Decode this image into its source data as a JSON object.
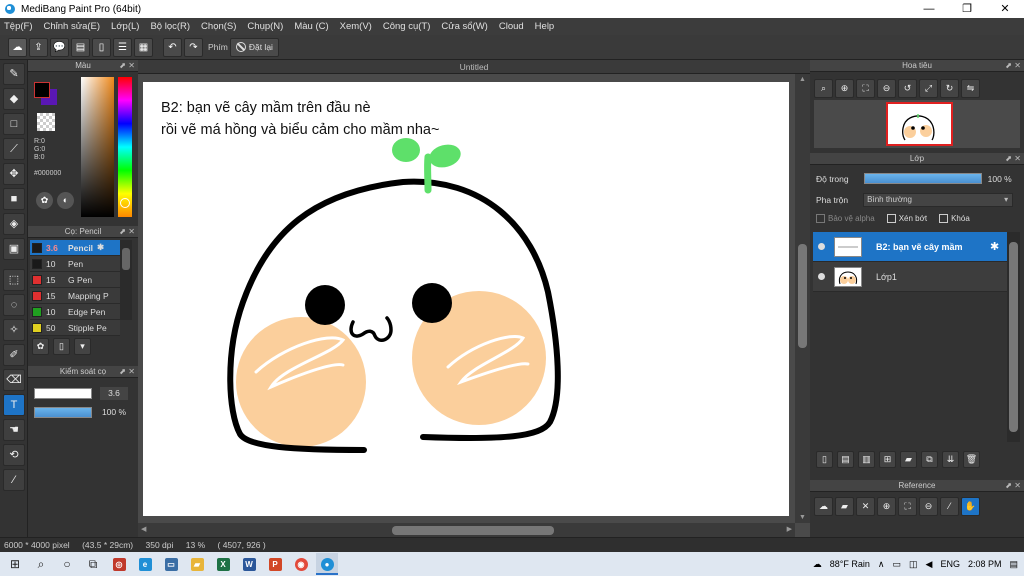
{
  "window": {
    "title": "MediBang Paint Pro (64bit)",
    "minimize": "—",
    "maximize": "❐",
    "close": "✕"
  },
  "menu": [
    "Tệp(F)",
    "Chỉnh sửa(E)",
    "Lớp(L)",
    "Bộ lọc(R)",
    "Chọn(S)",
    "Chụp(N)",
    "Màu (C)",
    "Xem(V)",
    "Công cụ(T)",
    "Cửa sổ(W)",
    "Cloud",
    "Help"
  ],
  "toolbar": {
    "hotkey_label": "Phím",
    "reset_label": "Đặt lại"
  },
  "color_panel": {
    "title": "Màu",
    "r": "R:0",
    "g": "G:0",
    "b": "B:0",
    "hex": "#000000",
    "fg_color": "#000000",
    "bg_color": "#5a17b4"
  },
  "brush_panel": {
    "title": "Cọ: Pencil",
    "brushes": [
      {
        "size": "3.6",
        "name": "Pencil",
        "color": "#1a1a1a",
        "selected": true
      },
      {
        "size": "10",
        "name": "Pen",
        "color": "#1a1a1a"
      },
      {
        "size": "15",
        "name": "G Pen",
        "color": "#e03030"
      },
      {
        "size": "15",
        "name": "Mapping P",
        "color": "#e03030"
      },
      {
        "size": "10",
        "name": "Edge Pen",
        "color": "#20a020"
      },
      {
        "size": "50",
        "name": "Stipple Pe",
        "color": "#e0d020"
      }
    ]
  },
  "control_panel": {
    "title": "Kiểm soát cọ",
    "size_value": "3.6",
    "opacity_value": "100 %"
  },
  "canvas": {
    "doc_title": "Untitled",
    "instruction_line1": "B2: bạn vẽ cây mầm trên đầu nè",
    "instruction_line2": "rồi vẽ má hồng và biểu cảm cho mầm nha~"
  },
  "navigator": {
    "title": "Hoa tiêu"
  },
  "layer_panel": {
    "title": "Lớp",
    "opacity_label": "Độ trong",
    "opacity_value": "100 %",
    "opacity": 1.0,
    "blend_label": "Pha trộn",
    "blend_value": "Bình thường",
    "protect_alpha": "Bảo vệ alpha",
    "clipping": "Xén bớt",
    "lock": "Khóa",
    "layers": [
      {
        "name": "B2: bạn vẽ cây mầm",
        "selected": true
      },
      {
        "name": "Lớp1",
        "selected": false
      }
    ]
  },
  "reference": {
    "title": "Reference"
  },
  "status": {
    "size": "6000 * 4000 pixel",
    "physical": "(43.5 * 29cm)",
    "dpi": "350 dpi",
    "zoom": "13 %",
    "coords": "( 4507, 926 )"
  },
  "taskbar": {
    "weather": "88°F Rain",
    "language": "ENG",
    "time": "2:08 PM"
  }
}
